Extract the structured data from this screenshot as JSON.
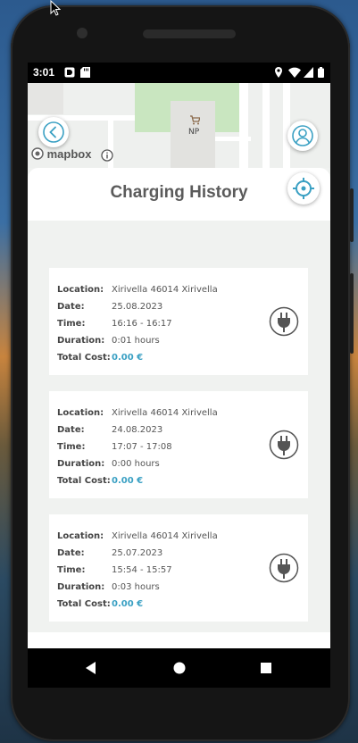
{
  "status": {
    "time": "3:01"
  },
  "map": {
    "attribution": "mapbox",
    "place_label": "NP"
  },
  "header": {
    "title": "Charging History"
  },
  "labels": {
    "location": "Location:",
    "date": "Date:",
    "time": "Time:",
    "duration": "Duration:",
    "total_cost": "Total Cost:"
  },
  "sessions": [
    {
      "location": "Xirivella 46014 Xirivella",
      "date": "25.08.2023",
      "time": "16:16 - 16:17",
      "duration": "0:01 hours",
      "cost": "0.00 €"
    },
    {
      "location": "Xirivella 46014 Xirivella",
      "date": "24.08.2023",
      "time": "17:07 - 17:08",
      "duration": "0:00 hours",
      "cost": "0.00 €"
    },
    {
      "location": "Xirivella 46014 Xirivella",
      "date": "25.07.2023",
      "time": "15:54 - 15:57",
      "duration": "0:03 hours",
      "cost": "0.00 €"
    }
  ],
  "colors": {
    "accent": "#3aa0c3",
    "title": "#5b5b5b"
  },
  "icons": {
    "back": "chevron-left-icon",
    "profile": "person-icon",
    "locate": "crosshair-icon",
    "plug": "plug-icon"
  }
}
